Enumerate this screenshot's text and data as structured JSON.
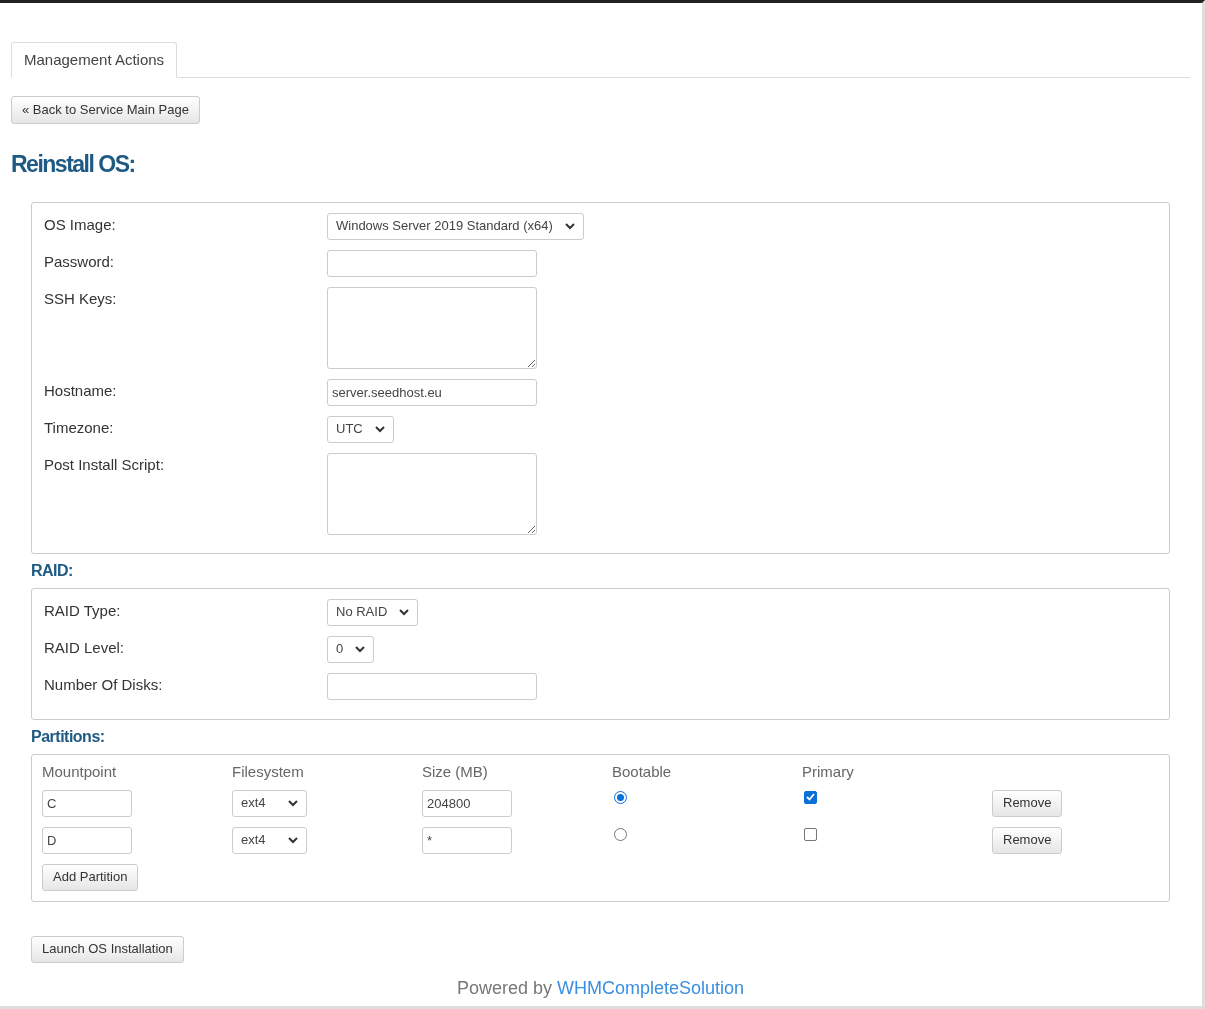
{
  "tabs": [
    {
      "label": "Management Actions",
      "selected": true
    }
  ],
  "back_button": "« Back to Service Main Page",
  "title": "Reinstall OS:",
  "os_fields": [
    {
      "label": "OS Image:",
      "kind": "select",
      "value": "Windows Server 2019 Standard (x64)"
    },
    {
      "label": "Password:",
      "kind": "text"
    },
    {
      "label": "SSH Keys:",
      "kind": "textarea"
    },
    {
      "label": "Hostname:",
      "kind": "text",
      "value": "server.seedhost.eu"
    },
    {
      "label": "Timezone:",
      "kind": "select",
      "value": "UTC"
    },
    {
      "label": "Post Install Script:",
      "kind": "textarea"
    }
  ],
  "raid_heading": "RAID:",
  "raid_fields": [
    {
      "label": "RAID Type:",
      "kind": "select",
      "value": "No RAID"
    },
    {
      "label": "RAID Level:",
      "kind": "select",
      "value": "0"
    },
    {
      "label": "Number Of Disks:",
      "kind": "text"
    }
  ],
  "partitions_heading": "Partitions:",
  "partition_columns": [
    "Mountpoint",
    "Filesystem",
    "Size (MB)",
    "Bootable",
    "Primary"
  ],
  "partitions": [
    {
      "mountpoint": "C",
      "filesystem": "ext4",
      "size": "204800",
      "bootable": true,
      "primary": true,
      "remove": "Remove"
    },
    {
      "mountpoint": "D",
      "filesystem": "ext4",
      "size": "*",
      "bootable": false,
      "primary": false,
      "remove": "Remove"
    }
  ],
  "add_partition": "Add Partition",
  "launch_button": "Launch OS Installation",
  "footer": {
    "text": "Powered by",
    "link": "WHMCompleteSolution"
  }
}
